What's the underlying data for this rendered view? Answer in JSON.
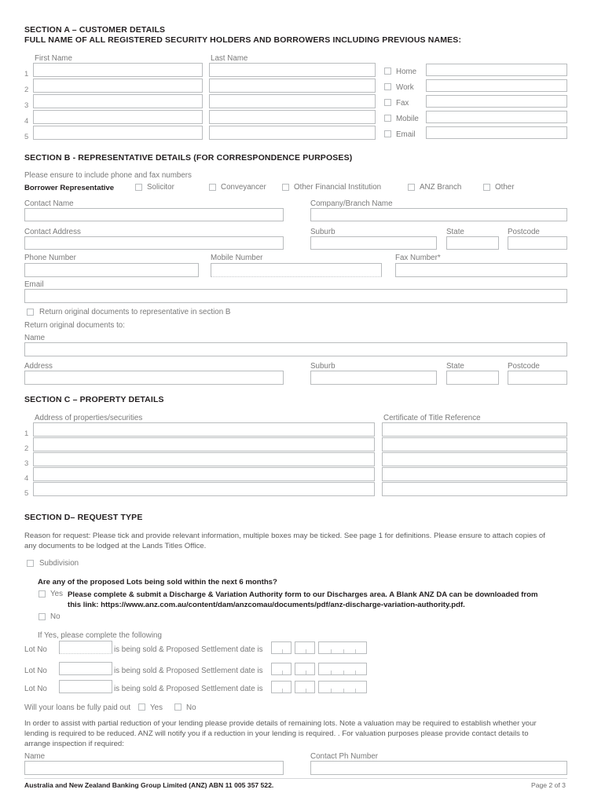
{
  "document": {
    "footer_legal": "Australia and New Zealand Banking Group Limited (ANZ) ABN 11 005 357 522.",
    "page_label": "Page 2 of 3"
  },
  "section_a": {
    "heading": "SECTION A – CUSTOMER DETAILS",
    "subheading": "FULL NAME OF ALL REGISTERED SECURITY HOLDERS AND BORROWERS INCLUDING PREVIOUS NAMES:",
    "col_first_name": "First Name",
    "col_last_name": "Last Name",
    "row_numbers": [
      "1",
      "2",
      "3",
      "4",
      "5"
    ],
    "first_name_values": [
      "",
      "",
      "",
      "",
      ""
    ],
    "last_name_values": [
      "",
      "",
      "",
      "",
      ""
    ],
    "contact_types": [
      {
        "label": "Home",
        "checked": false,
        "value": ""
      },
      {
        "label": "Work",
        "checked": false,
        "value": ""
      },
      {
        "label": "Fax",
        "checked": false,
        "value": ""
      },
      {
        "label": "Mobile",
        "checked": false,
        "value": ""
      },
      {
        "label": "Email",
        "checked": false,
        "value": ""
      }
    ]
  },
  "section_b": {
    "heading": "SECTION B - REPRESENTATIVE DETAILS (FOR CORRESPONDENCE PURPOSES)",
    "note": "Please ensure to include phone and fax numbers",
    "rep_label": "Borrower Representative",
    "rep_options": [
      {
        "label": "Solicitor",
        "checked": false
      },
      {
        "label": "Conveyancer",
        "checked": false
      },
      {
        "label": "Other Financial Institution",
        "checked": false
      },
      {
        "label": "ANZ Branch",
        "checked": false
      },
      {
        "label": "Other",
        "checked": false
      }
    ],
    "fields": {
      "contact_name_label": "Contact Name",
      "contact_name_value": "",
      "company_branch_label": "Company/Branch Name",
      "company_branch_value": "",
      "contact_address_label": "Contact Address",
      "contact_address_value": "",
      "suburb_label": "Suburb",
      "suburb_value": "",
      "state_label": "State",
      "state_value": "",
      "postcode_label": "Postcode",
      "postcode_value": "",
      "phone_label": "Phone Number",
      "phone_value": "",
      "mobile_label": "Mobile Number",
      "mobile_value": "",
      "fax_label": "Fax Number*",
      "fax_value": "",
      "email_label": "Email",
      "email_value": ""
    },
    "return_checkbox_label": "Return original documents to representative in section B",
    "return_checkbox_checked": false,
    "return_to_label": "Return original documents to:",
    "return_fields": {
      "name_label": "Name",
      "name_value": "",
      "address_label": "Address",
      "address_value": "",
      "suburb_label": "Suburb",
      "suburb_value": "",
      "state_label": "State",
      "state_value": "",
      "postcode_label": "Postcode",
      "postcode_value": ""
    }
  },
  "section_c": {
    "heading": "SECTION C – PROPERTY DETAILS",
    "col_address": "Address of properties/securities",
    "col_title_ref": "Certificate of Title Reference",
    "row_numbers": [
      "1",
      "2",
      "3",
      "4",
      "5"
    ],
    "address_values": [
      "",
      "",
      "",
      "",
      ""
    ],
    "title_ref_values": [
      "",
      "",
      "",
      "",
      ""
    ]
  },
  "section_d": {
    "heading": "SECTION D– REQUEST TYPE",
    "intro_line1": "Reason for request: Please tick and provide relevant information, multiple boxes may be ticked. See page 1 for definitions. Please ensure to attach copies of",
    "intro_line2": "any documents to be lodged at the Lands Titles Office.",
    "subdivision_label": "Subdivision",
    "subdivision_checked": false,
    "question": "Are any of the proposed Lots being sold within the next 6 months?",
    "yes_label": "Yes",
    "yes_checked": false,
    "yes_instruction_line1": "Please complete & submit a Discharge & Variation Authority form to our Discharges area. A Blank ANZ DA can be downloaded from",
    "yes_instruction_line2": "this link: https://www.anz.com.au/content/dam/anzcomau/documents/pdf/anz-discharge-variation-authority.pdf.",
    "no_label": "No",
    "no_checked": false,
    "if_yes_label": "If Yes, please complete the following",
    "lot_rows": [
      {
        "lot_label": "Lot No",
        "lot_value": "",
        "mid_text": "is being sold & Proposed Settlement date is",
        "day": "",
        "month": "",
        "year": ""
      },
      {
        "lot_label": "Lot No",
        "lot_value": "",
        "mid_text": "is being sold & Proposed Settlement date is",
        "day": "",
        "month": "",
        "year": ""
      },
      {
        "lot_label": "Lot No",
        "lot_value": "",
        "mid_text": "is being sold & Proposed Settlement date is",
        "day": "",
        "month": "",
        "year": ""
      }
    ],
    "paid_out_question": "Will your loans be fully paid out",
    "paid_out_yes": "Yes",
    "paid_out_yes_checked": false,
    "paid_out_no": "No",
    "paid_out_no_checked": false,
    "valuation_line1": "In order to assist with partial reduction of your lending please provide details of remaining lots. Note a valuation may be required to establish whether your",
    "valuation_line2": "lending is required to be reduced. ANZ will notify you if a reduction in your lending is required. . For valuation purposes please provide contact details to",
    "valuation_line3": "arrange inspection if required:",
    "contact_name_label": "Name",
    "contact_name_value": "",
    "contact_ph_label": "Contact Ph Number",
    "contact_ph_value": ""
  }
}
